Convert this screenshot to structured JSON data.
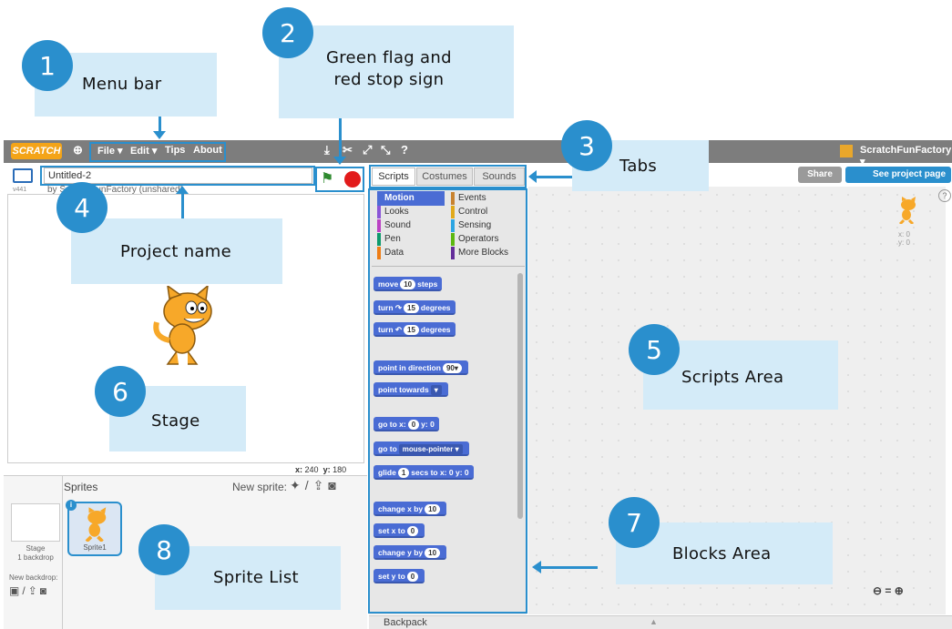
{
  "callouts": [
    {
      "num": "1",
      "label": "Menu bar"
    },
    {
      "num": "2",
      "label": "Green flag and\nred stop sign"
    },
    {
      "num": "3",
      "label": "Tabs"
    },
    {
      "num": "4",
      "label": "Project name"
    },
    {
      "num": "5",
      "label": "Scripts Area"
    },
    {
      "num": "6",
      "label": "Stage"
    },
    {
      "num": "7",
      "label": "Blocks Area"
    },
    {
      "num": "8",
      "label": "Sprite List"
    }
  ],
  "menubar": {
    "logo": "SCRATCH",
    "items": [
      "File ▾",
      "Edit ▾",
      "Tips",
      "About"
    ],
    "username": "ScratchFunFactory ▾"
  },
  "project": {
    "title": "Untitled-2",
    "byline": "by ScratchFunFactory (unshared)",
    "version": "v441"
  },
  "stage_coords": {
    "x_label": "x:",
    "x": "240",
    "y_label": "y:",
    "y": "180"
  },
  "tabs": [
    "Scripts",
    "Costumes",
    "Sounds"
  ],
  "header_buttons": {
    "share": "Share",
    "see_project": "See project page"
  },
  "categories": [
    {
      "name": "Motion",
      "color": "#4a6cd4"
    },
    {
      "name": "Events",
      "color": "#c88330"
    },
    {
      "name": "Looks",
      "color": "#8a55d7"
    },
    {
      "name": "Control",
      "color": "#e1a91a"
    },
    {
      "name": "Sound",
      "color": "#bb42c3"
    },
    {
      "name": "Sensing",
      "color": "#2ca5e2"
    },
    {
      "name": "Pen",
      "color": "#0e9a6c"
    },
    {
      "name": "Operators",
      "color": "#5cb712"
    },
    {
      "name": "Data",
      "color": "#ee7d16"
    },
    {
      "name": "More Blocks",
      "color": "#632d99"
    }
  ],
  "blocks": [
    {
      "pre": "move",
      "pill": "10",
      "post": "steps"
    },
    {
      "pre": "turn ↷",
      "pill": "15",
      "post": "degrees"
    },
    {
      "pre": "turn ↶",
      "pill": "15",
      "post": "degrees"
    },
    {
      "pre": "point in direction",
      "pill": "90▾",
      "post": ""
    },
    {
      "pre": "point towards",
      "pill": "▾",
      "post": ""
    },
    {
      "pre": "go to x:",
      "pill": "0",
      "post": "y: 0"
    },
    {
      "pre": "go to",
      "pill": "mouse-pointer ▾",
      "post": ""
    },
    {
      "pre": "glide",
      "pill": "1",
      "post": "secs to x: 0 y: 0"
    },
    {
      "pre": "change x by",
      "pill": "10",
      "post": ""
    },
    {
      "pre": "set x to",
      "pill": "0",
      "post": ""
    },
    {
      "pre": "change y by",
      "pill": "10",
      "post": ""
    },
    {
      "pre": "set y to",
      "pill": "0",
      "post": ""
    }
  ],
  "sprite_readout": {
    "x": "x: 0",
    "y": "y: 0"
  },
  "sprites_panel": {
    "title": "Sprites",
    "new_sprite": "New sprite:",
    "stage_label": "Stage",
    "backdrop_count": "1 backdrop",
    "new_backdrop": "New backdrop:",
    "sprite_name": "Sprite1"
  },
  "backpack": "Backpack",
  "zoom": {
    "out": "🔍−",
    "reset": "=",
    "in": "🔍+"
  },
  "colors": {
    "accent": "#2a8fcd",
    "callout_bg": "#d4ebf8",
    "menubar": "#7d7d7d",
    "motion": "#4a6cd4"
  }
}
